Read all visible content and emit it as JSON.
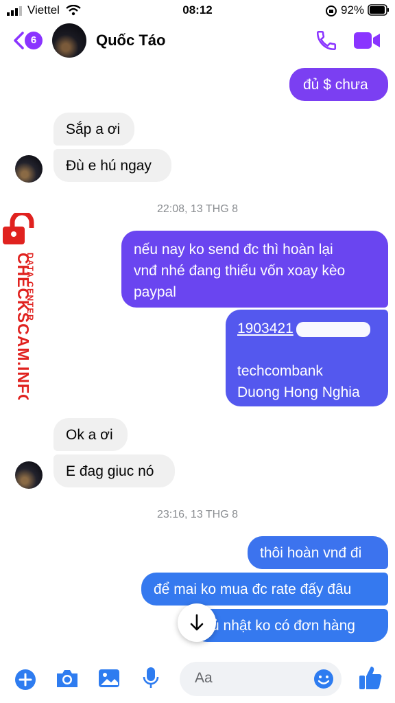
{
  "status_bar": {
    "carrier": "Viettel",
    "time": "08:12",
    "battery": "92%"
  },
  "header": {
    "back_badge": "6",
    "contact_name": "Quốc Táo"
  },
  "messages": {
    "m1": "đủ $ chưa",
    "m2": "Sắp a ơi",
    "m3": "Đù e hú ngay",
    "t1": "22:08, 13 THG 8",
    "m4_l1": "nếu nay ko send đc thì hoàn lại",
    "m4_l2": "vnđ nhé đang thiếu vốn xoay kèo",
    "m4_l3": "paypal",
    "m5_account": "1903421",
    "m5_bank": "techcombank",
    "m5_name": "Duong Hong Nghia",
    "m6": "Ok a ơi",
    "m7": "E đag giuc nó",
    "t2": "23:16, 13 THG 8",
    "m8": "thôi hoàn vnđ đi",
    "m9": "để mai ko mua đc rate đấy đâu",
    "m10": "ủ nhật ko có đơn hàng"
  },
  "watermark": {
    "line1": "CHECKSCAM.INFO",
    "line2": "DATA CENTER"
  },
  "composer": {
    "placeholder": "Aa"
  },
  "colors": {
    "accent": "#8a34ff",
    "bubble_in": "#f0f0f0",
    "watermark": "#e0221f"
  }
}
